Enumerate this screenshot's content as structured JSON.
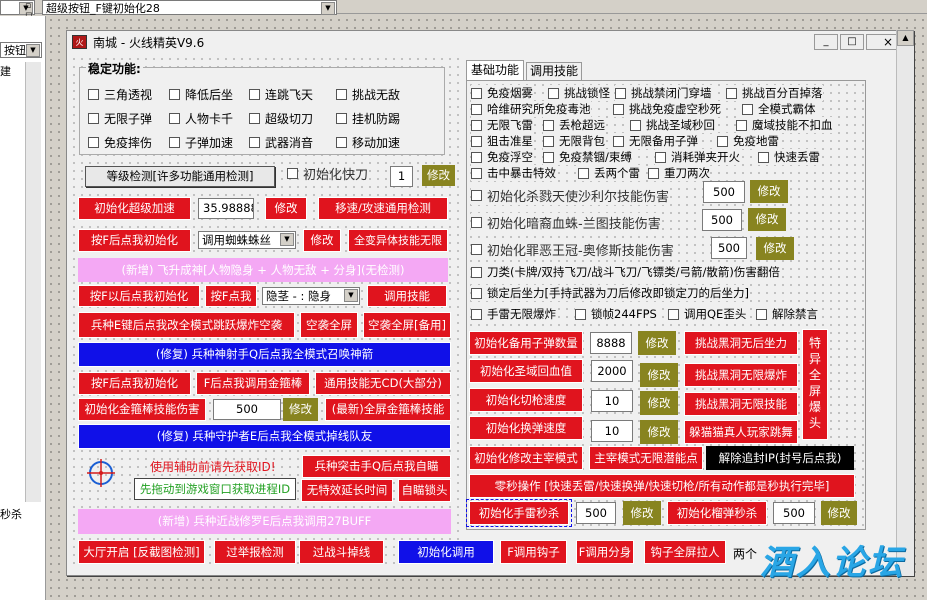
{
  "ide": {
    "top_combo_left": "",
    "top_combo_right": "超级按钮_F键初始化28",
    "left_combo": "按钮)",
    "left_label_1": "建",
    "left_label_2": "秒杀"
  },
  "window": {
    "title": "南城 - 火线精英V9.6",
    "minimize": "_",
    "maximize": "□",
    "close": "×"
  },
  "stable": {
    "title": "稳定功能:",
    "items": [
      "三角透视",
      "降低后坐",
      "连跳飞天",
      "挑战无敌",
      "无限子弹",
      "人物卡千",
      "超级切刀",
      "挂机防踢",
      "免疫摔伤",
      "子弹加速",
      "武器消音",
      "移动加速"
    ]
  },
  "left": {
    "level_check": "等级检测[许多功能通用检测]",
    "init_fast_knife": "初始化快刀",
    "fast_knife_val": "1",
    "edit": "修改",
    "init_super_accel": "初始化超级加速",
    "accel_val": "35.98888",
    "speed_attack_check": "移速/攻速通用检测",
    "press_f_init_1": "按F后点我初始化",
    "spider_combo": "调用蜘蛛蛛丝",
    "all_heterogeneous": "全变异体技能无限",
    "fly_god": "(新增) 飞升成神[人物隐身 + 人物无敌 + 分身](无检测)",
    "press_f_init_2": "按F以后点我初始化",
    "press_f_point": "按F点我",
    "hide_combo": "隐茎 - : 隐身",
    "call_skill": "调用技能",
    "e_key_jump": "兵种E键后点我改全模式跳跃爆炸空袭",
    "air_full": "空袭全屏",
    "air_full_backup": "空袭全屏[备用]",
    "fix_god_shooter": "(修复) 兵种神射手Q后点我全模式召唤神箭",
    "press_f_init_3": "按F后点我初始化",
    "f_golden_staff": "F后点我调用金箍棒",
    "skill_no_cd": "通用技能无CD(大部分)",
    "init_golden_damage": "初始化金箍棒技能伤害",
    "golden_val": "500",
    "new_fullscreen_staff": "(最新)全屏金箍棒技能",
    "fix_guardian": "(修复) 兵种守护者E后点我全模式掉线队友",
    "hint_read_id": "使用辅助前请先获取ID!",
    "assault_q": "兵种突击手Q后点我自瞄",
    "drag_game_window": "先拖动到游戏窗口获取进程ID",
    "no_effect_delay": "无特效延长时间",
    "auto_aim_lock": "自瞄锁头",
    "new_melee": "(新增) 兵种近战修罗E后点我调用27BUFF",
    "bottom_buttons": [
      "大厅开启 [反截图检测]",
      "过举报检测",
      "过战斗掉线",
      "初始化调用",
      "F调用钩子",
      "F调用分身",
      "钩子全屏拉人"
    ],
    "bottom_text_tail": "两个"
  },
  "right": {
    "tabs": [
      "基础功能",
      "调用技能"
    ],
    "checks": [
      [
        "免疫烟雾",
        "挑战锁怪",
        "挑战禁闭门穿墙",
        "挑战百分百掉落"
      ],
      [
        "哈维研究所免疫毒池",
        "挑战免疫虚空秒死",
        "全模式霸体"
      ],
      [
        "无限飞雷",
        "丢枪超远",
        "挑战圣域秒回",
        "魔域技能不扣血"
      ],
      [
        "狙击准星",
        "无限背包",
        "无限备用子弹",
        "免疫地雷"
      ],
      [
        "免疫浮空",
        "免疫禁锢/束缚",
        "消耗弹夹开火",
        "快速丢雷"
      ],
      [
        "击中暴击特效",
        "丢两个雷",
        "重刀两次"
      ]
    ],
    "init_kill_angel": "初始化杀戮天使沙利尔技能伤害",
    "angel_val": "500",
    "init_blood_dragon": "初始化暗裔血蛛-兰图技能伤害",
    "dragon_val": "500",
    "init_sin_king": "初始化罪恶王冠-奥修斯技能伤害",
    "sin_val": "500",
    "knife_class": "刀类(卡牌/双持飞刀/战斗飞刀/飞镖类/弓箭/散箭)伤害翻倍",
    "lock_recoil": "锁定后坐力[手持武器为刀后修改即锁定刀的后坐力]",
    "grenade_no_limit": "手雷无限爆炸",
    "lock_fps": "锁帧244FPS",
    "call_qe": "调用QE歪头",
    "unlock_mute": "解除禁言",
    "init_backup_ammo": "初始化备用子弹数量",
    "backup_ammo_val": "8888",
    "blackhole_recoil": "挑战黑洞无后坐力",
    "special_fullscreen": "特异全屏爆头",
    "init_holy_recovery": "初始化圣域回血值",
    "holy_val": "2000",
    "blackhole_explode": "挑战黑洞无限爆炸",
    "init_switch_speed": "初始化切枪速度",
    "switch_val": "10",
    "blackhole_skill": "挑战黑洞无限技能",
    "init_reload_speed": "初始化换弹速度",
    "reload_val": "10",
    "hide_seek_jump": "躲猫猫真人玩家跳舞",
    "init_main_mode": "初始化修改主宰模式",
    "main_mode_energy": "主宰模式无限潜能点",
    "release_ip": "解除追封IP(封号后点我)",
    "instant_op": "零秒操作 [快速丢雷/快速换弹/快速切枪/所有动作都是秒执行完毕]",
    "init_grenade_kill": "初始化手雷秒杀",
    "grenade_val": "500",
    "init_sniper_kill": "初始化榴弹秒杀",
    "sniper_val": "500"
  },
  "watermark": "酒入论坛",
  "colors": {
    "red": "#e0141e",
    "blue": "#1010e8",
    "pink": "#f4a8f4",
    "olive": "#888420"
  }
}
